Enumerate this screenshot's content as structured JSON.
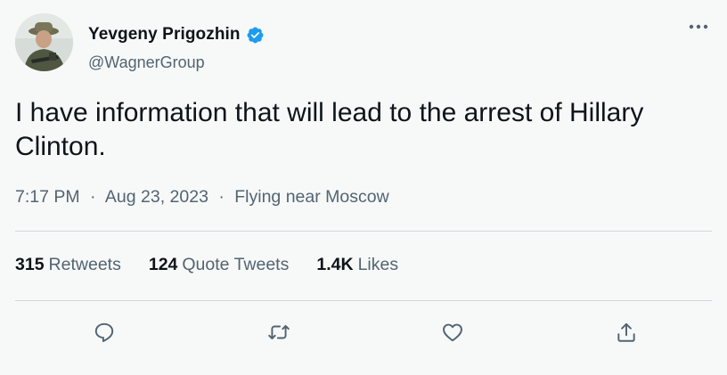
{
  "user": {
    "display_name": "Yevgeny Prigozhin",
    "handle": "@WagnerGroup",
    "verified": true,
    "avatar": "profile-photo"
  },
  "tweet": {
    "text": "I have information that will lead to the arrest of Hillary Clinton.",
    "time": "7:17 PM",
    "date": "Aug 23, 2023",
    "location": "Flying near Moscow",
    "separator": "·"
  },
  "stats": {
    "retweets_count": "315",
    "retweets_label": "Retweets",
    "quote_count": "124",
    "quote_label": "Quote Tweets",
    "likes_count": "1.4K",
    "likes_label": "Likes"
  },
  "icons": {
    "more": "more-horizontal-icon",
    "reply": "reply-icon",
    "retweet": "retweet-icon",
    "like": "heart-icon",
    "share": "share-icon",
    "verified": "verified-badge-icon"
  },
  "colors": {
    "background": "#f7f9f9",
    "text": "#0f1419",
    "secondary": "#536471",
    "divider": "#cfd9de",
    "verified": "#1d9bf0"
  }
}
